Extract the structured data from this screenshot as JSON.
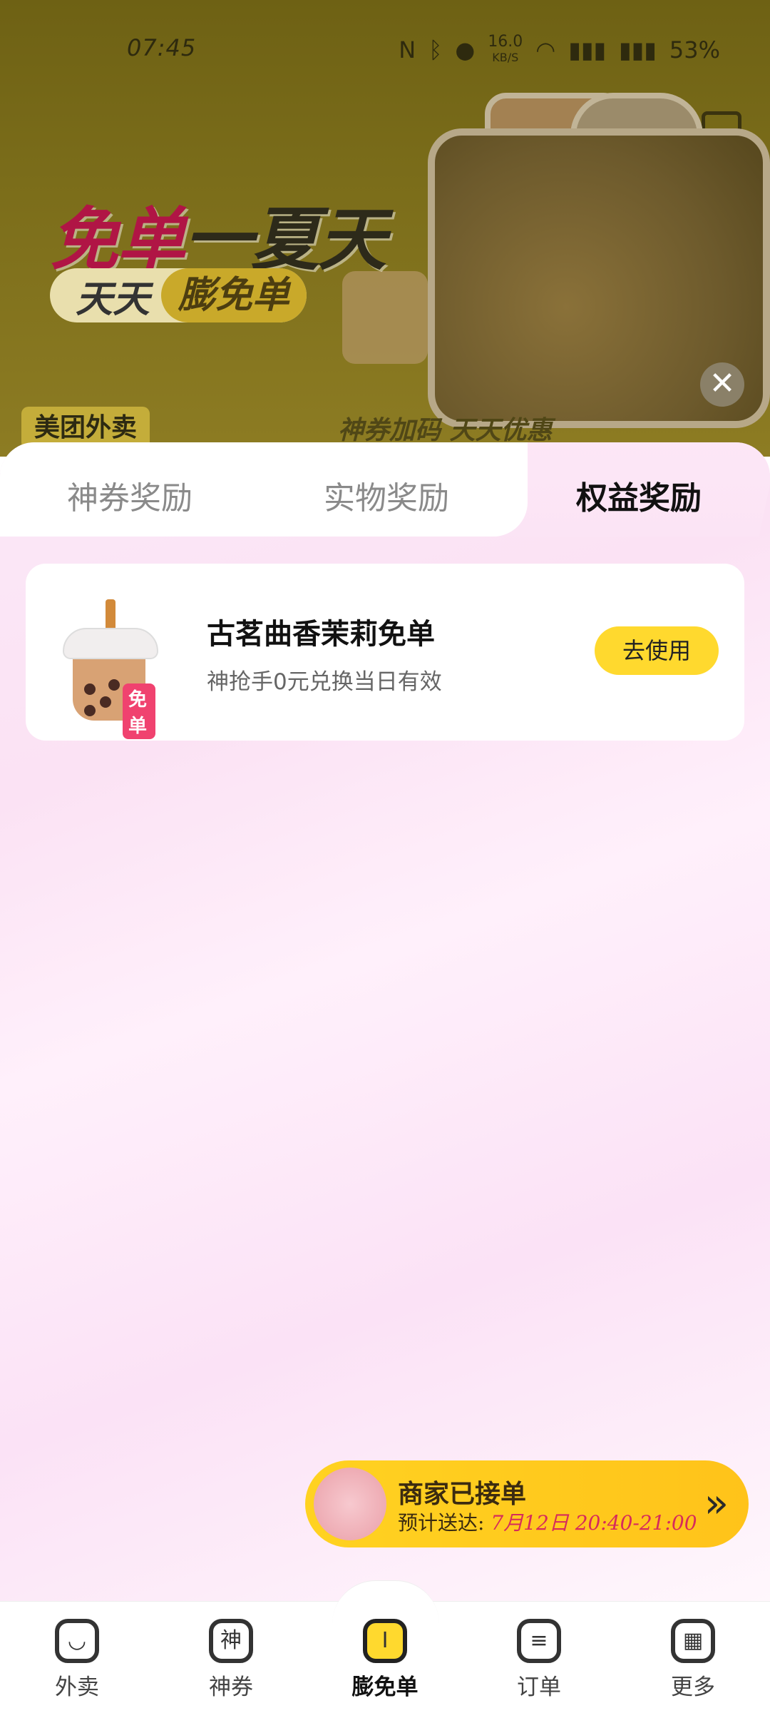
{
  "status_bar": {
    "time": "07:45",
    "icons": [
      "nfc-icon",
      "bluetooth-icon",
      "location-icon",
      "wifi-icon",
      "signal-icon",
      "signal-icon"
    ],
    "speed": "16.0",
    "speed_unit": "KB/S",
    "battery": "53%"
  },
  "banner": {
    "title_red": "免单",
    "title_dark": "一夏天",
    "chip_left": "天天",
    "chip_right": "膨免单",
    "brand": "美团外卖",
    "slogan": "神券加码 天天优惠"
  },
  "tabs": [
    {
      "label": "神券奖励",
      "active": false
    },
    {
      "label": "实物奖励",
      "active": false
    },
    {
      "label": "权益奖励",
      "active": true
    }
  ],
  "reward_card": {
    "title": "古茗曲香茉莉免单",
    "subtitle": "神抢手0元兑换当日有效",
    "tag": "免单",
    "button": "去使用",
    "button_color": "#FFD92E"
  },
  "order_status": {
    "title": "商家已接单",
    "eta_label": "预计送达:",
    "eta_time": "7月12日 20:40-21:00"
  },
  "bottom_nav": [
    {
      "label": "外卖",
      "icon": "takeout-icon",
      "glyph": "◡"
    },
    {
      "label": "神券",
      "icon": "coupon-icon",
      "glyph": "神"
    },
    {
      "label": "膨免单",
      "icon": "free-order-icon",
      "glyph": "I",
      "active": true
    },
    {
      "label": "订单",
      "icon": "order-icon",
      "glyph": "≡"
    },
    {
      "label": "更多",
      "icon": "more-icon",
      "glyph": "▦"
    }
  ]
}
